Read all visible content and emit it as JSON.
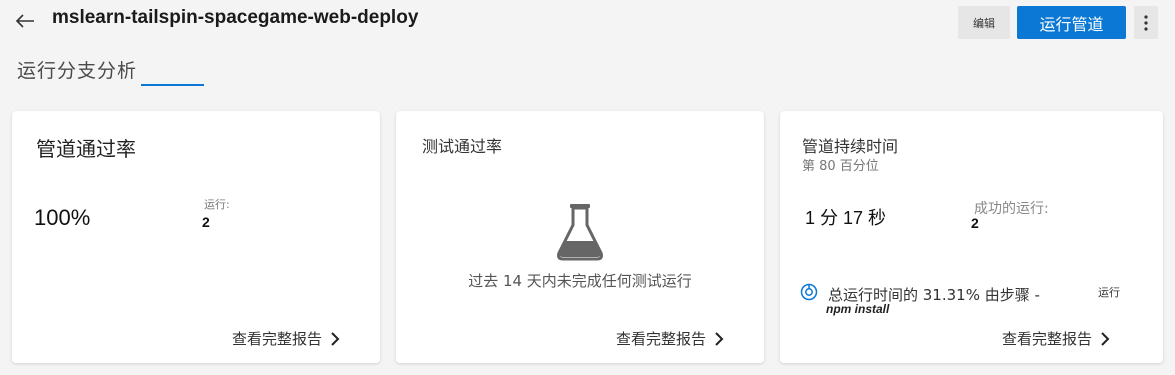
{
  "header": {
    "title": "mslearn-tailspin-spacegame-web-deploy",
    "edit_label": "编辑",
    "run_label": "运行管道"
  },
  "tab": {
    "label": "运行分支分析"
  },
  "cards": {
    "pass_rate": {
      "title": "管道通过率",
      "value": "100%",
      "runs_label": "运行:",
      "runs_value": "2",
      "link": "查看完整报告"
    },
    "test_pass_rate": {
      "title": "测试通过率",
      "empty_message": "过去 14 天内未完成任何测试运行",
      "link": "查看完整报告"
    },
    "duration": {
      "title": "管道持续时间",
      "subtitle": "第 80 百分位",
      "value": "1 分 17 秒",
      "success_label": "成功的运行:",
      "success_value": "2",
      "insight_text": "总运行时间的 31.31% 由步骤 -",
      "insight_tag": "运行",
      "insight_step": "npm install",
      "link": "查看完整报告"
    }
  },
  "colors": {
    "accent": "#0a78d4",
    "background": "#f4f4f4",
    "card": "#ffffff",
    "flask": "#666666"
  },
  "icons": [
    "back-arrow-icon",
    "more-vertical-icon",
    "flask-icon",
    "chevron-right-icon",
    "insight-icon"
  ]
}
